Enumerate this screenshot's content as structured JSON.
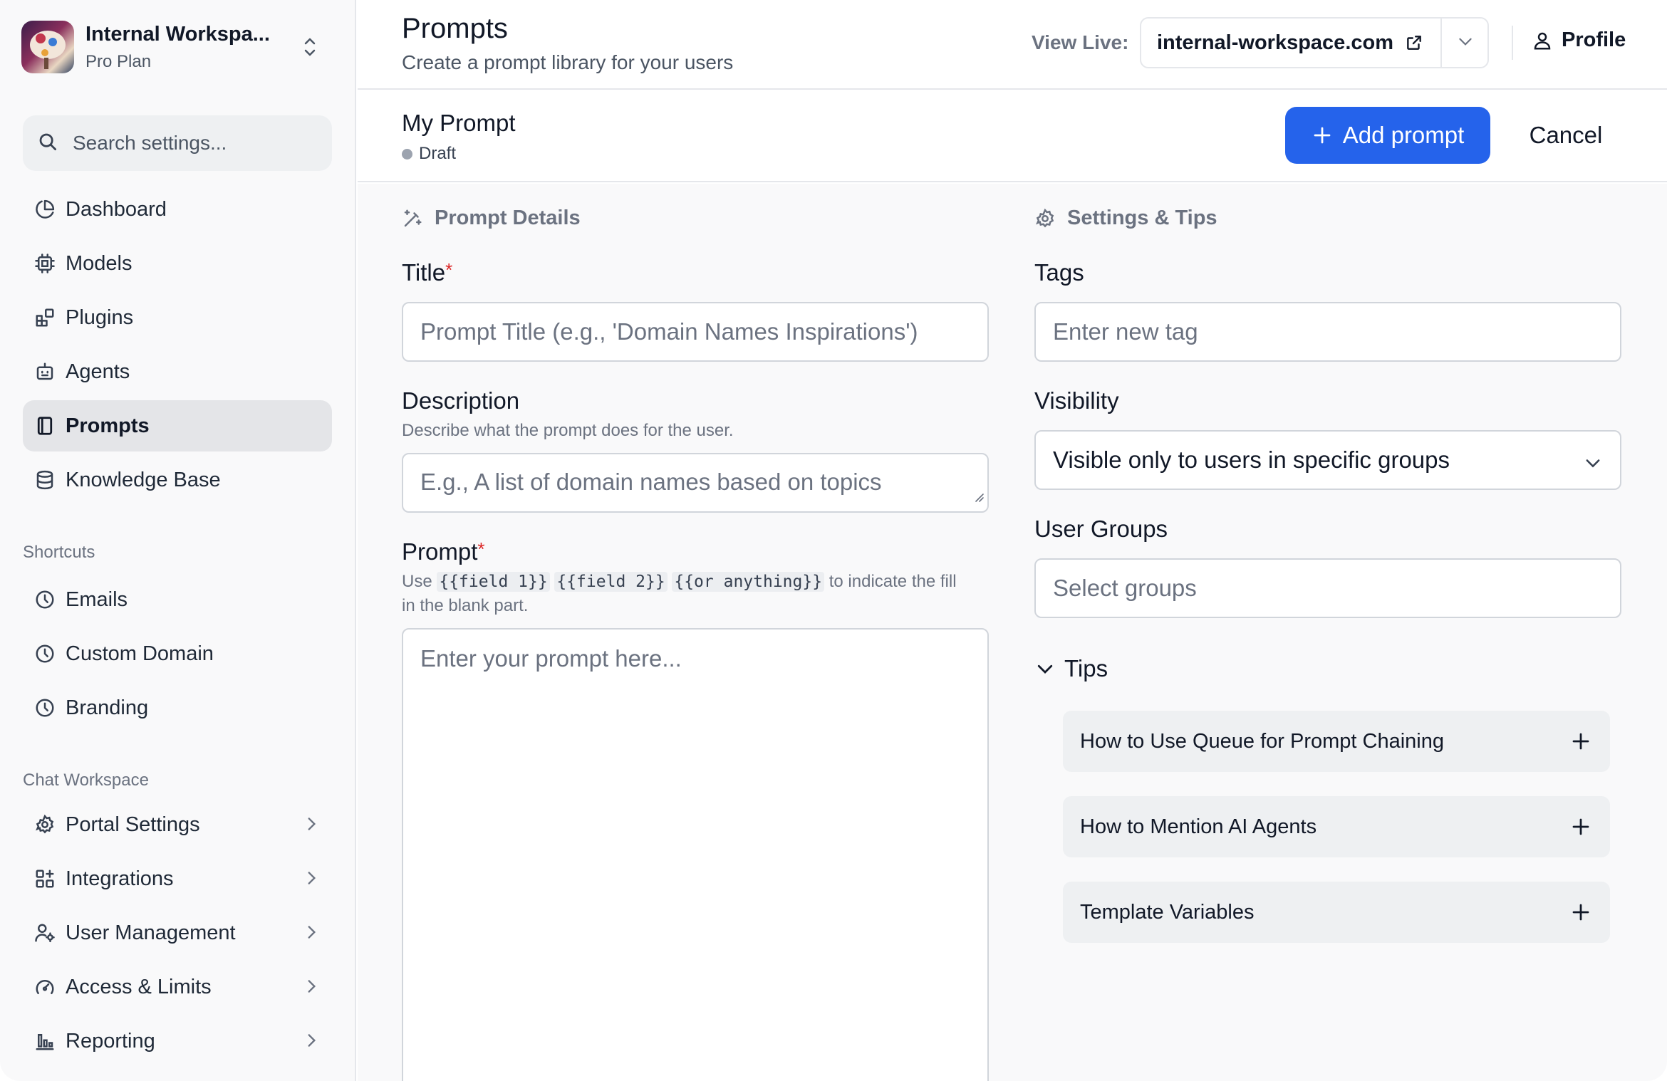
{
  "workspace": {
    "name": "Internal Workspa...",
    "plan": "Pro Plan"
  },
  "search": {
    "placeholder": "Search settings..."
  },
  "nav": {
    "items": [
      {
        "label": "Dashboard",
        "icon": "pie-chart-icon"
      },
      {
        "label": "Models",
        "icon": "cpu-icon"
      },
      {
        "label": "Plugins",
        "icon": "blocks-icon"
      },
      {
        "label": "Agents",
        "icon": "bot-icon"
      },
      {
        "label": "Prompts",
        "icon": "notebook-icon",
        "active": true
      },
      {
        "label": "Knowledge Base",
        "icon": "database-icon"
      }
    ],
    "shortcuts_label": "Shortcuts",
    "shortcuts": [
      {
        "label": "Emails",
        "icon": "clock-icon"
      },
      {
        "label": "Custom Domain",
        "icon": "clock-icon"
      },
      {
        "label": "Branding",
        "icon": "clock-icon"
      }
    ],
    "chat_workspace_label": "Chat Workspace",
    "chat_workspace": [
      {
        "label": "Portal Settings",
        "icon": "gear-icon"
      },
      {
        "label": "Integrations",
        "icon": "grid-plus-icon"
      },
      {
        "label": "User Management",
        "icon": "users-gear-icon"
      },
      {
        "label": "Access & Limits",
        "icon": "gauge-icon"
      },
      {
        "label": "Reporting",
        "icon": "bar-chart-icon"
      }
    ]
  },
  "header": {
    "title": "Prompts",
    "subtitle": "Create a prompt library for your users",
    "view_live_label": "View Live:",
    "domain": "internal-workspace.com",
    "profile_label": "Profile"
  },
  "prompt_bar": {
    "name": "My Prompt",
    "status": "Draft",
    "add_label": "Add prompt",
    "cancel_label": "Cancel"
  },
  "details": {
    "heading": "Prompt Details",
    "title_label": "Title",
    "title_placeholder": "Prompt Title (e.g., 'Domain Names Inspirations')",
    "description_label": "Description",
    "description_help": "Describe what the prompt does for the user.",
    "description_placeholder": "E.g., A list of domain names based on topics",
    "prompt_label": "Prompt",
    "prompt_help_prefix": "Use",
    "prompt_help_code1": "{{field 1}}",
    "prompt_help_code2": "{{field 2}}",
    "prompt_help_code3": "{{or anything}}",
    "prompt_help_suffix": "to indicate the fill",
    "prompt_help_line2": "in the blank part.",
    "prompt_placeholder": "Enter your prompt here..."
  },
  "settings": {
    "heading": "Settings & Tips",
    "tags_label": "Tags",
    "tags_placeholder": "Enter new tag",
    "visibility_label": "Visibility",
    "visibility_value": "Visible only to users in specific groups",
    "groups_label": "User Groups",
    "groups_placeholder": "Select groups",
    "tips_label": "Tips",
    "tips": [
      "How to Use Queue for Prompt Chaining",
      "How to Mention AI Agents",
      "Template Variables"
    ]
  },
  "colors": {
    "accent": "#2563eb",
    "required": "#dc2626",
    "draft_dot": "#9ca3af"
  }
}
